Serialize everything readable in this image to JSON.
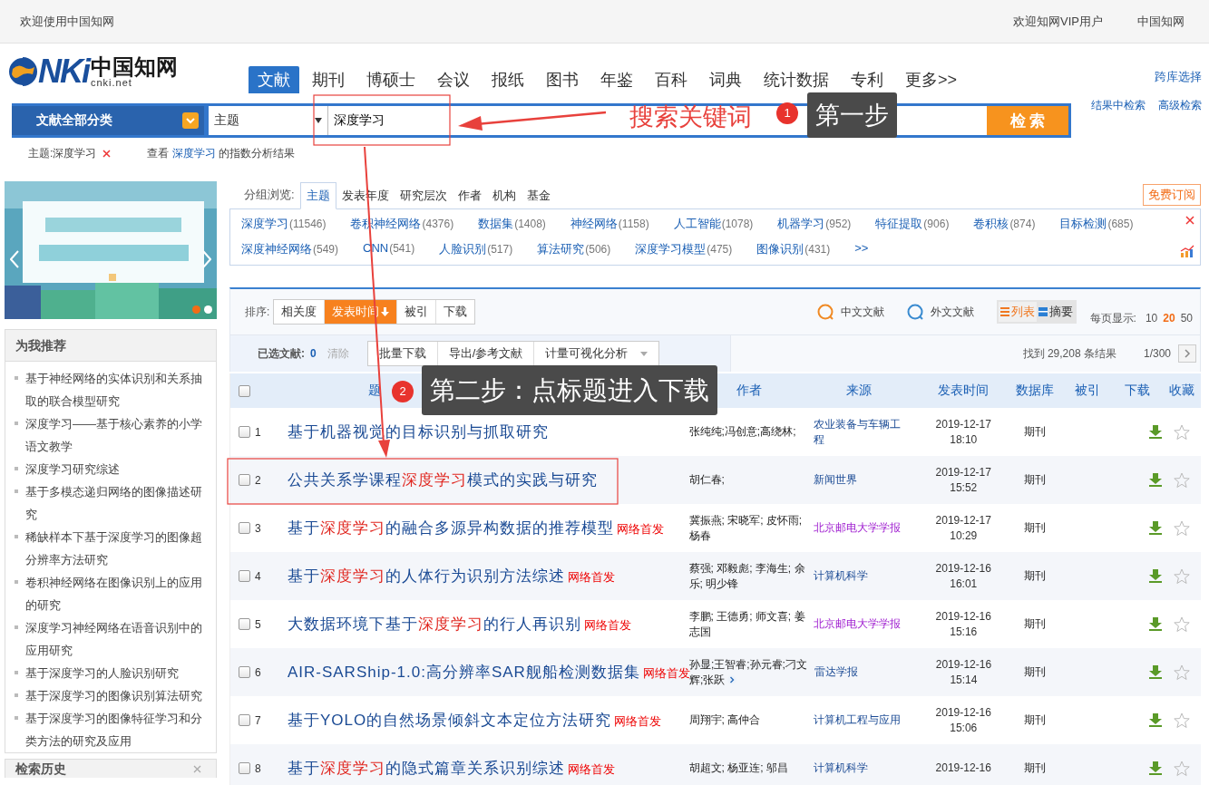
{
  "top_bar": {
    "welcome": "欢迎使用中国知网",
    "links": [
      "欢迎知网VIP用户",
      "中国知网"
    ]
  },
  "logo": {
    "wordmark": "NKi",
    "chinese": "中国知网",
    "domain": "cnki.net"
  },
  "nav_tabs": [
    {
      "label": "文献",
      "selected": true
    },
    {
      "label": "期刊",
      "selected": false
    },
    {
      "label": "博硕士",
      "selected": false
    },
    {
      "label": "会议",
      "selected": false
    },
    {
      "label": "报纸",
      "selected": false
    },
    {
      "label": "图书",
      "selected": false
    },
    {
      "label": "年鉴",
      "selected": false
    },
    {
      "label": "百科",
      "selected": false
    },
    {
      "label": "词典",
      "selected": false
    },
    {
      "label": "统计数据",
      "selected": false
    },
    {
      "label": "专利",
      "selected": false
    },
    {
      "label": "更多>>",
      "selected": false
    }
  ],
  "side_links": {
    "top": "跨库选择",
    "bottom": [
      "结果中检索",
      "高级检索"
    ]
  },
  "search": {
    "category": "文献全部分类",
    "field": "主题",
    "value": "深度学习",
    "button": "检 索"
  },
  "query_summary": {
    "tag": "主题:深度学习",
    "prefix": "查看",
    "keyword": "深度学习",
    "suffix": "的指数分析结果"
  },
  "group_browse": {
    "label": "分组浏览:",
    "subscribe": "免费订阅",
    "more": ">>",
    "tabs": [
      {
        "label": "主题",
        "selected": true
      },
      {
        "label": "发表年度",
        "selected": false
      },
      {
        "label": "研究层次",
        "selected": false
      },
      {
        "label": "作者",
        "selected": false
      },
      {
        "label": "机构",
        "selected": false
      },
      {
        "label": "基金",
        "selected": false
      }
    ],
    "terms": [
      {
        "name": "深度学习",
        "count": "(11546)"
      },
      {
        "name": "卷积神经网络",
        "count": "(4376)"
      },
      {
        "name": "数据集",
        "count": "(1408)"
      },
      {
        "name": "神经网络",
        "count": "(1158)"
      },
      {
        "name": "人工智能",
        "count": "(1078)"
      },
      {
        "name": "机器学习",
        "count": "(952)"
      },
      {
        "name": "特征提取",
        "count": "(906)"
      },
      {
        "name": "卷积核",
        "count": "(874)"
      },
      {
        "name": "目标检测",
        "count": "(685)"
      },
      {
        "name": "深度神经网络",
        "count": "(549)"
      },
      {
        "name": "CNN",
        "count": "(541)"
      },
      {
        "name": "人脸识别",
        "count": "(517)"
      },
      {
        "name": "算法研究",
        "count": "(506)"
      },
      {
        "name": "深度学习模型",
        "count": "(475)"
      },
      {
        "name": "图像识别",
        "count": "(431)"
      }
    ]
  },
  "sort": {
    "label": "排序:",
    "options": [
      {
        "label": "相关度",
        "selected": false
      },
      {
        "label": "发表时间",
        "selected": true
      },
      {
        "label": "被引",
        "selected": false
      },
      {
        "label": "下载",
        "selected": false
      }
    ],
    "languages": [
      {
        "label": "中文文献",
        "kind": "zh"
      },
      {
        "label": "外文文献",
        "kind": "en"
      }
    ],
    "views": [
      {
        "label": "列表",
        "selected": true
      },
      {
        "label": "摘要",
        "selected": false
      }
    ],
    "per_page_label": "每页显示:",
    "per_page": [
      {
        "label": "10",
        "selected": false
      },
      {
        "label": "20",
        "selected": true
      },
      {
        "label": "50",
        "selected": false
      }
    ]
  },
  "selection": {
    "label": "已选文献:",
    "count": "0",
    "clear": "清除",
    "actions": [
      "批量下载",
      "导出/参考文献",
      "计量可视化分析"
    ],
    "found": "找到 29,208 条结果",
    "page": "1/300"
  },
  "table": {
    "select_all": false,
    "columns": [
      "题",
      "作者",
      "来源",
      "发表时间",
      "数据库",
      "被引",
      "下载",
      "收藏"
    ],
    "rows": [
      {
        "number": "1",
        "checked": false,
        "title": [
          {
            "text": "基于机器视觉的目标识别与抓取研究",
            "hit": false
          }
        ],
        "authors": "张纯纯;冯创意;高绕林;",
        "more_authors": false,
        "source": "农业装备与车辆工程",
        "source_visited": false,
        "date": "2019-12-17",
        "time": "18:10",
        "database": "期刊"
      },
      {
        "number": "2",
        "checked": false,
        "title": [
          {
            "text": "公共关系学课程",
            "hit": false
          },
          {
            "text": "深度学习",
            "hit": true
          },
          {
            "text": "模式的实践与研究",
            "hit": false
          }
        ],
        "authors": "胡仁春;",
        "more_authors": false,
        "source": "新闻世界",
        "source_visited": false,
        "date": "2019-12-17",
        "time": "15:52",
        "database": "期刊"
      },
      {
        "number": "3",
        "checked": false,
        "title": [
          {
            "text": "基于",
            "hit": false
          },
          {
            "text": "深度学习",
            "hit": true
          },
          {
            "text": "的融合多源异构数据的推荐模型",
            "hit": false
          }
        ],
        "badge": "网络首发",
        "authors": "冀振燕; 宋晓军; 皮怀雨; 杨春",
        "more_authors": false,
        "source": "北京邮电大学学报",
        "source_visited": true,
        "date": "2019-12-17",
        "time": "10:29",
        "database": "期刊"
      },
      {
        "number": "4",
        "checked": false,
        "title": [
          {
            "text": "基于",
            "hit": false
          },
          {
            "text": "深度学习",
            "hit": true
          },
          {
            "text": "的人体行为识别方法综述",
            "hit": false
          }
        ],
        "badge": "网络首发",
        "authors": "蔡强; 邓毅彪; 李海生; 余乐; 明少锋",
        "more_authors": false,
        "source": "计算机科学",
        "source_visited": false,
        "date": "2019-12-16",
        "time": "16:01",
        "database": "期刊"
      },
      {
        "number": "5",
        "checked": false,
        "title": [
          {
            "text": "大数据环境下基于",
            "hit": false
          },
          {
            "text": "深度学习",
            "hit": true
          },
          {
            "text": "的行人再识别",
            "hit": false
          }
        ],
        "badge": "网络首发",
        "authors": "李鹏; 王德勇; 师文喜; 姜志国",
        "more_authors": false,
        "source": "北京邮电大学学报",
        "source_visited": true,
        "date": "2019-12-16",
        "time": "15:16",
        "database": "期刊"
      },
      {
        "number": "6",
        "checked": false,
        "title": [
          {
            "text": "AIR-SARShip-1.0:高分辨率SAR舰船检测数据集",
            "hit": false
          }
        ],
        "badge": "网络首发",
        "authors": "孙显;王智睿;孙元睿;刁文辉;张跃",
        "more_authors": true,
        "source": "雷达学报",
        "source_visited": false,
        "date": "2019-12-16",
        "time": "15:14",
        "database": "期刊"
      },
      {
        "number": "7",
        "checked": false,
        "title": [
          {
            "text": "基于YOLO的自然场景倾斜文本定位方法研究",
            "hit": false
          }
        ],
        "badge": "网络首发",
        "authors": "周翔宇; 高仲合",
        "more_authors": false,
        "source": "计算机工程与应用",
        "source_visited": false,
        "date": "2019-12-16",
        "time": "15:06",
        "database": "期刊"
      },
      {
        "number": "8",
        "checked": false,
        "title": [
          {
            "text": "基于",
            "hit": false
          },
          {
            "text": "深度学习",
            "hit": true
          },
          {
            "text": "的隐式篇章关系识别综述",
            "hit": false
          }
        ],
        "badge": "网络首发",
        "authors": "胡超文; 杨亚连; 邬昌",
        "more_authors": false,
        "source": "计算机科学",
        "source_visited": false,
        "date": "2019-12-16",
        "database": "期刊"
      }
    ]
  },
  "sidebar": {
    "banner": {
      "kind": "picture",
      "slides": [
        {
          "selected": true
        },
        {
          "selected": false
        }
      ]
    },
    "recommend": {
      "title": "为我推荐",
      "items": [
        "基于神经网络的实体识别和关系抽取的联合模型研究",
        "深度学习——基于核心素养的小学语文教学",
        "深度学习研究综述",
        "基于多模态递归网络的图像描述研究",
        "稀缺样本下基于深度学习的图像超分辨率方法研究",
        "卷积神经网络在图像识别上的应用的研究",
        "深度学习神经网络在语音识别中的应用研究",
        "基于深度学习的人脸识别研究",
        "基于深度学习的图像识别算法研究",
        "基于深度学习的图像特征学习和分类方法的研究及应用"
      ]
    },
    "history": {
      "title": "检索历史"
    }
  },
  "annotations": {
    "step1": {
      "caption": "搜索关键词",
      "badge": "1",
      "label": "第一步"
    },
    "step2": {
      "badge": "2",
      "label": "第二步：点标题进入下载"
    }
  }
}
